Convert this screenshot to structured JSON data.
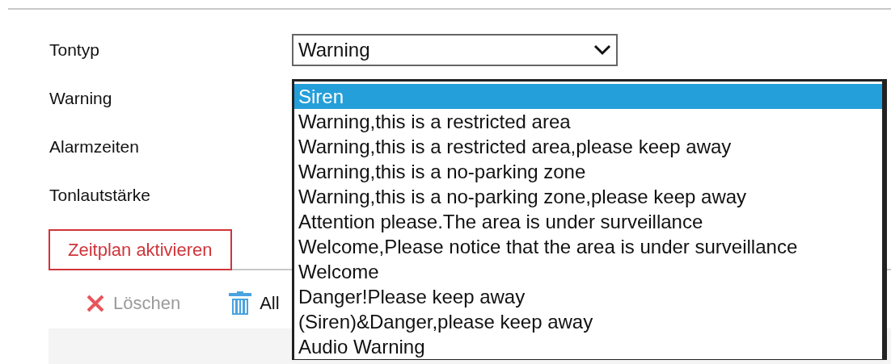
{
  "form": {
    "fields": [
      {
        "label": "Tontyp"
      },
      {
        "label": "Warning"
      },
      {
        "label": "Alarmzeiten"
      },
      {
        "label": "Tonlautstärke"
      }
    ],
    "select": {
      "value": "Warning",
      "expanded": true,
      "options": [
        {
          "label": "Siren",
          "selected": true
        },
        {
          "label": "Warning,this is a restricted area",
          "selected": false
        },
        {
          "label": "Warning,this is a restricted area,please keep away",
          "selected": false
        },
        {
          "label": "Warning,this is a no-parking zone",
          "selected": false
        },
        {
          "label": "Warning,this is a no-parking zone,please keep away",
          "selected": false
        },
        {
          "label": "Attention please.The area is under surveillance",
          "selected": false
        },
        {
          "label": "Welcome,Please notice that the area is under surveillance",
          "selected": false
        },
        {
          "label": "Welcome",
          "selected": false
        },
        {
          "label": "Danger!Please keep away",
          "selected": false
        },
        {
          "label": "(Siren)&Danger,please keep away",
          "selected": false
        },
        {
          "label": "Audio Warning",
          "selected": false
        }
      ]
    }
  },
  "schedule_tab": {
    "label": "Zeitplan aktivieren"
  },
  "toolbar": [
    {
      "label": "Löschen",
      "disabled": true
    },
    {
      "label": "All",
      "disabled": false
    }
  ]
}
